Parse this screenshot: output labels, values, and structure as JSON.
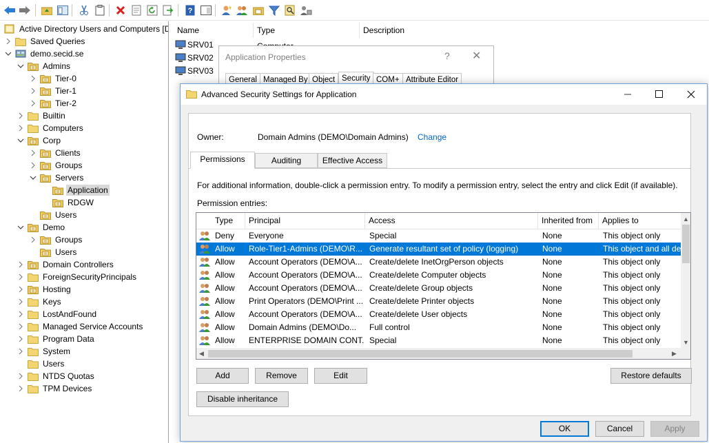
{
  "toolbar": {
    "icons": [
      "back-arrow-icon",
      "forward-arrow-icon",
      "up-folder-icon",
      "show-hide-tree-icon",
      "cut-icon",
      "copy-icon",
      "delete-icon",
      "properties-icon",
      "refresh-icon",
      "export-list-icon",
      "help-icon",
      "action-pane-icon",
      "add-user-icon",
      "add-group-icon",
      "add-ou-icon",
      "filter-icon",
      "find-icon",
      "move-icon"
    ]
  },
  "tree": {
    "root": "Active Directory Users and Computers [D",
    "items": [
      {
        "label": "Saved Queries"
      },
      {
        "label": "demo.secid.se"
      },
      {
        "label": "Admins"
      },
      {
        "label": "Tier-0"
      },
      {
        "label": "Tier-1"
      },
      {
        "label": "Tier-2"
      },
      {
        "label": "Builtin"
      },
      {
        "label": "Computers"
      },
      {
        "label": "Corp"
      },
      {
        "label": "Clients"
      },
      {
        "label": "Groups"
      },
      {
        "label": "Servers"
      },
      {
        "label": "Application"
      },
      {
        "label": "RDGW"
      },
      {
        "label": "Users"
      },
      {
        "label": "Demo"
      },
      {
        "label": "Groups"
      },
      {
        "label": "Users"
      },
      {
        "label": "Domain Controllers"
      },
      {
        "label": "ForeignSecurityPrincipals"
      },
      {
        "label": "Hosting"
      },
      {
        "label": "Keys"
      },
      {
        "label": "LostAndFound"
      },
      {
        "label": "Managed Service Accounts"
      },
      {
        "label": "Program Data"
      },
      {
        "label": "System"
      },
      {
        "label": "Users"
      },
      {
        "label": "NTDS Quotas"
      },
      {
        "label": "TPM Devices"
      }
    ],
    "selected": "Application"
  },
  "listview": {
    "headers": [
      "Name",
      "Type",
      "Description"
    ],
    "rows": [
      {
        "name": "SRV01",
        "type": "Computer"
      },
      {
        "name": "SRV02"
      },
      {
        "name": "SRV03"
      }
    ]
  },
  "app_properties": {
    "title": "Application Properties",
    "help": "?",
    "close": "✕",
    "tabs": [
      "General",
      "Managed By",
      "Object",
      "Security",
      "COM+",
      "Attribute Editor"
    ]
  },
  "advanced": {
    "title": "Advanced Security Settings for Application",
    "owner_label": "Owner:",
    "owner_value": "Domain Admins (DEMO\\Domain Admins)",
    "change_link": "Change",
    "tabs": [
      "Permissions",
      "Auditing",
      "Effective Access"
    ],
    "info_text": "For additional information, double-click a permission entry. To modify a permission entry, select the entry and click Edit (if available).",
    "entries_label": "Permission entries:",
    "columns": [
      "Type",
      "Principal",
      "Access",
      "Inherited from",
      "Applies to"
    ],
    "entries": [
      {
        "type": "Deny",
        "principal": "Everyone",
        "access": "Special",
        "inherited": "None",
        "applies": "This object only"
      },
      {
        "type": "Allow",
        "principal": "Role-Tier1-Admins (DEMO\\R...",
        "access": "Generate resultant set of policy (logging)",
        "inherited": "None",
        "applies": "This object and all de"
      },
      {
        "type": "Allow",
        "principal": "Account Operators (DEMO\\A...",
        "access": "Create/delete InetOrgPerson objects",
        "inherited": "None",
        "applies": "This object only"
      },
      {
        "type": "Allow",
        "principal": "Account Operators (DEMO\\A...",
        "access": "Create/delete Computer objects",
        "inherited": "None",
        "applies": "This object only"
      },
      {
        "type": "Allow",
        "principal": "Account Operators (DEMO\\A...",
        "access": "Create/delete Group objects",
        "inherited": "None",
        "applies": "This object only"
      },
      {
        "type": "Allow",
        "principal": "Print Operators (DEMO\\Print ...",
        "access": "Create/delete Printer objects",
        "inherited": "None",
        "applies": "This object only"
      },
      {
        "type": "Allow",
        "principal": "Account Operators (DEMO\\A...",
        "access": "Create/delete User objects",
        "inherited": "None",
        "applies": "This object only"
      },
      {
        "type": "Allow",
        "principal": "Domain Admins (DEMO\\Do...",
        "access": "Full control",
        "inherited": "None",
        "applies": "This object only"
      },
      {
        "type": "Allow",
        "principal": "ENTERPRISE DOMAIN CONT...",
        "access": "Special",
        "inherited": "None",
        "applies": "This object only"
      }
    ],
    "selected_index": 1,
    "buttons": {
      "add": "Add",
      "remove": "Remove",
      "edit": "Edit",
      "restore": "Restore defaults",
      "disable_inheritance": "Disable inheritance",
      "ok": "OK",
      "cancel": "Cancel",
      "apply": "Apply"
    }
  },
  "colors": {
    "selection": "#0078d7",
    "link": "#0066cc",
    "folder": "#e8c256"
  }
}
